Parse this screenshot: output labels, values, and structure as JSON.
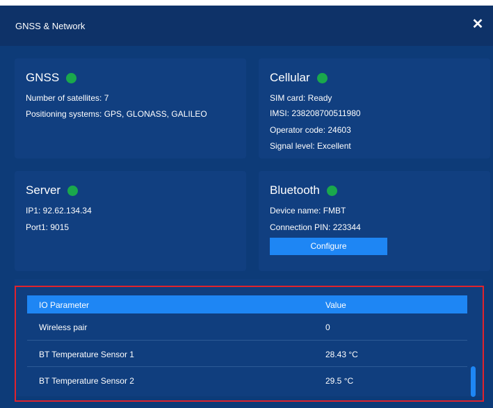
{
  "dialog": {
    "title": "GNSS & Network",
    "close_label": "✕"
  },
  "gnss": {
    "title": "GNSS",
    "satellites": "Number of satellites: 7",
    "systems": "Positioning systems: GPS, GLONASS, GALILEO"
  },
  "cellular": {
    "title": "Cellular",
    "sim": "SIM card: Ready",
    "imsi": "IMSI: 238208700511980",
    "operator": "Operator code: 24603",
    "signal": "Signal level: Excellent"
  },
  "server": {
    "title": "Server",
    "ip": "IP1: 92.62.134.34",
    "port": "Port1: 9015"
  },
  "bluetooth": {
    "title": "Bluetooth",
    "device": "Device name: FMBT",
    "pin": "Connection PIN: 223344",
    "configure_label": "Configure"
  },
  "io_table": {
    "headers": [
      "IO Parameter",
      "Value"
    ],
    "rows": [
      {
        "param": "Wireless pair",
        "value": "0"
      },
      {
        "param": "BT Temperature Sensor 1",
        "value": "28.43 °C"
      },
      {
        "param": "BT Temperature Sensor 2",
        "value": "29.5 °C"
      }
    ]
  },
  "colors": {
    "background": "#0d3b78",
    "header": "#0e3268",
    "card": "#113f80",
    "accent": "#1e86f4",
    "status_ok": "#1aa84c",
    "highlight_border": "#e0232d"
  }
}
